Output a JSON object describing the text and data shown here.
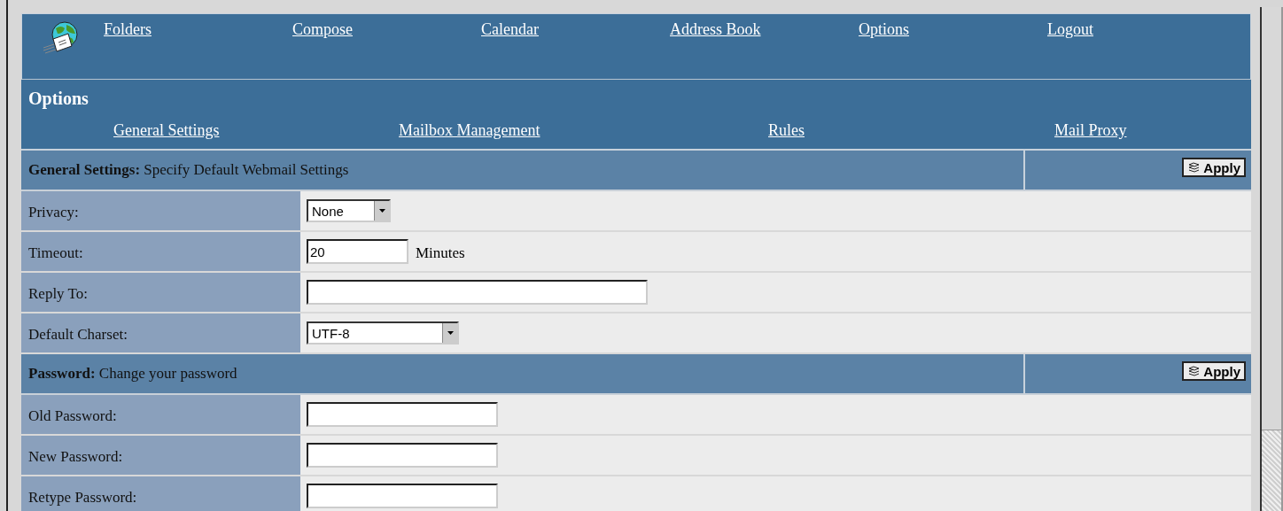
{
  "nav": {
    "links": [
      "Folders",
      "Compose",
      "Calendar",
      "Address Book",
      "Options",
      "Logout"
    ]
  },
  "options": {
    "title": "Options",
    "tabs": [
      "General Settings",
      "Mailbox Management",
      "Rules",
      "Mail Proxy"
    ]
  },
  "sections": [
    {
      "title": "General Settings:",
      "description": "Specify Default Webmail Settings",
      "apply": "Apply",
      "rows": [
        {
          "kind": "select",
          "label": "Privacy:",
          "value": "None"
        },
        {
          "kind": "text",
          "label": "Timeout:",
          "value": "20",
          "suffix": "Minutes"
        },
        {
          "kind": "text",
          "label": "Reply To:"
        },
        {
          "kind": "select",
          "label": "Default Charset:",
          "value": "UTF-8"
        }
      ]
    },
    {
      "title": "Password:",
      "description": "Change your password",
      "apply": "Apply",
      "rows": [
        {
          "kind": "password",
          "label": "Old Password:"
        },
        {
          "kind": "password",
          "label": "New Password:"
        },
        {
          "kind": "password",
          "label": "Retype Password:"
        }
      ]
    }
  ]
}
